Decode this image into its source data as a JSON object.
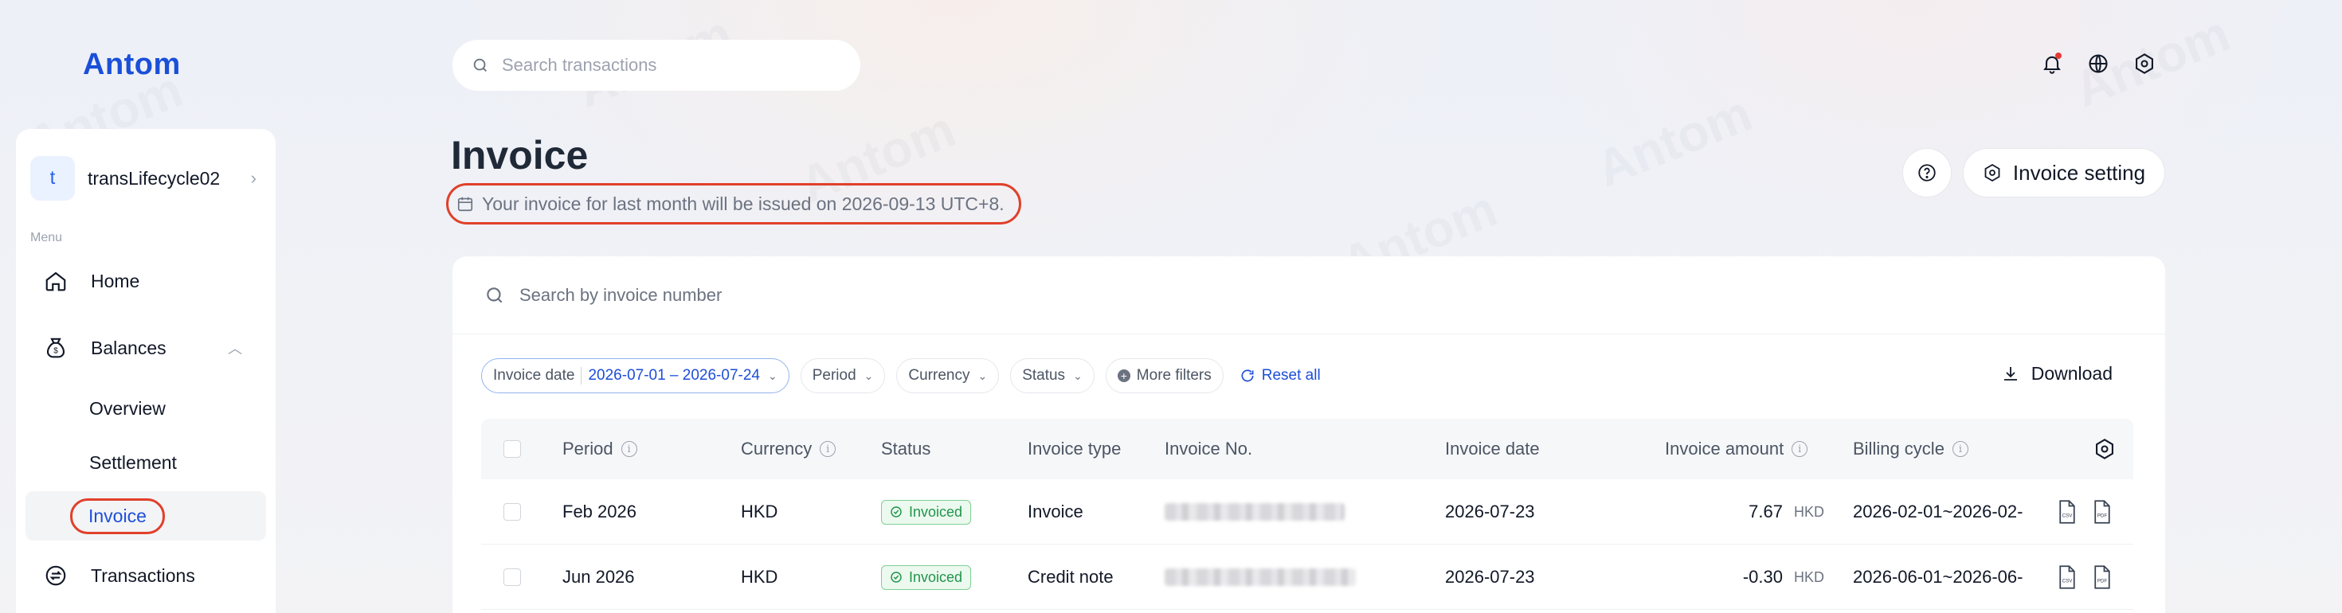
{
  "app": {
    "logo": "Antom"
  },
  "sidebar": {
    "account": {
      "initial": "t",
      "name": "transLifecycle02"
    },
    "menu_label": "Menu",
    "items": [
      {
        "label": "Home",
        "icon": "home-icon"
      },
      {
        "label": "Balances",
        "icon": "balances-icon",
        "expanded": true
      },
      {
        "label": "Overview"
      },
      {
        "label": "Settlement"
      },
      {
        "label": "Invoice",
        "active": true
      },
      {
        "label": "Transactions",
        "icon": "transactions-icon"
      }
    ]
  },
  "header": {
    "search_placeholder": "Search transactions",
    "icons": [
      "bell-icon",
      "globe-icon",
      "settings-icon"
    ]
  },
  "page": {
    "title": "Invoice",
    "notice": "Your invoice for last month will be issued on 2026-09-13 UTC+8.",
    "invoice_setting_label": "Invoice setting"
  },
  "card": {
    "search_placeholder": "Search by invoice number",
    "filters": {
      "date_label": "Invoice date",
      "date_value": "2026-07-01 – 2026-07-24",
      "period": "Period",
      "currency": "Currency",
      "status": "Status",
      "more": "More filters",
      "reset": "Reset all"
    },
    "download_label": "Download",
    "table": {
      "columns": {
        "period": "Period",
        "currency": "Currency",
        "status": "Status",
        "invoice_type": "Invoice type",
        "invoice_no": "Invoice No.",
        "invoice_date": "Invoice date",
        "invoice_amount": "Invoice amount",
        "billing_cycle": "Billing cycle"
      },
      "rows": [
        {
          "period": "Feb 2026",
          "currency": "HKD",
          "status": "Invoiced",
          "invoice_type": "Invoice",
          "invoice_date": "2026-07-23",
          "amount": "7.67",
          "amount_currency": "HKD",
          "billing_cycle": "2026-02-01~2026-02-"
        },
        {
          "period": "Jun 2026",
          "currency": "HKD",
          "status": "Invoiced",
          "invoice_type": "Credit note",
          "invoice_date": "2026-07-23",
          "amount": "-0.30",
          "amount_currency": "HKD",
          "billing_cycle": "2026-06-01~2026-06-"
        }
      ]
    }
  },
  "colors": {
    "brand": "#1a4fd8",
    "accent_link": "#1d4ed8",
    "highlight_ring": "#e0402a",
    "success": "#20954a"
  }
}
